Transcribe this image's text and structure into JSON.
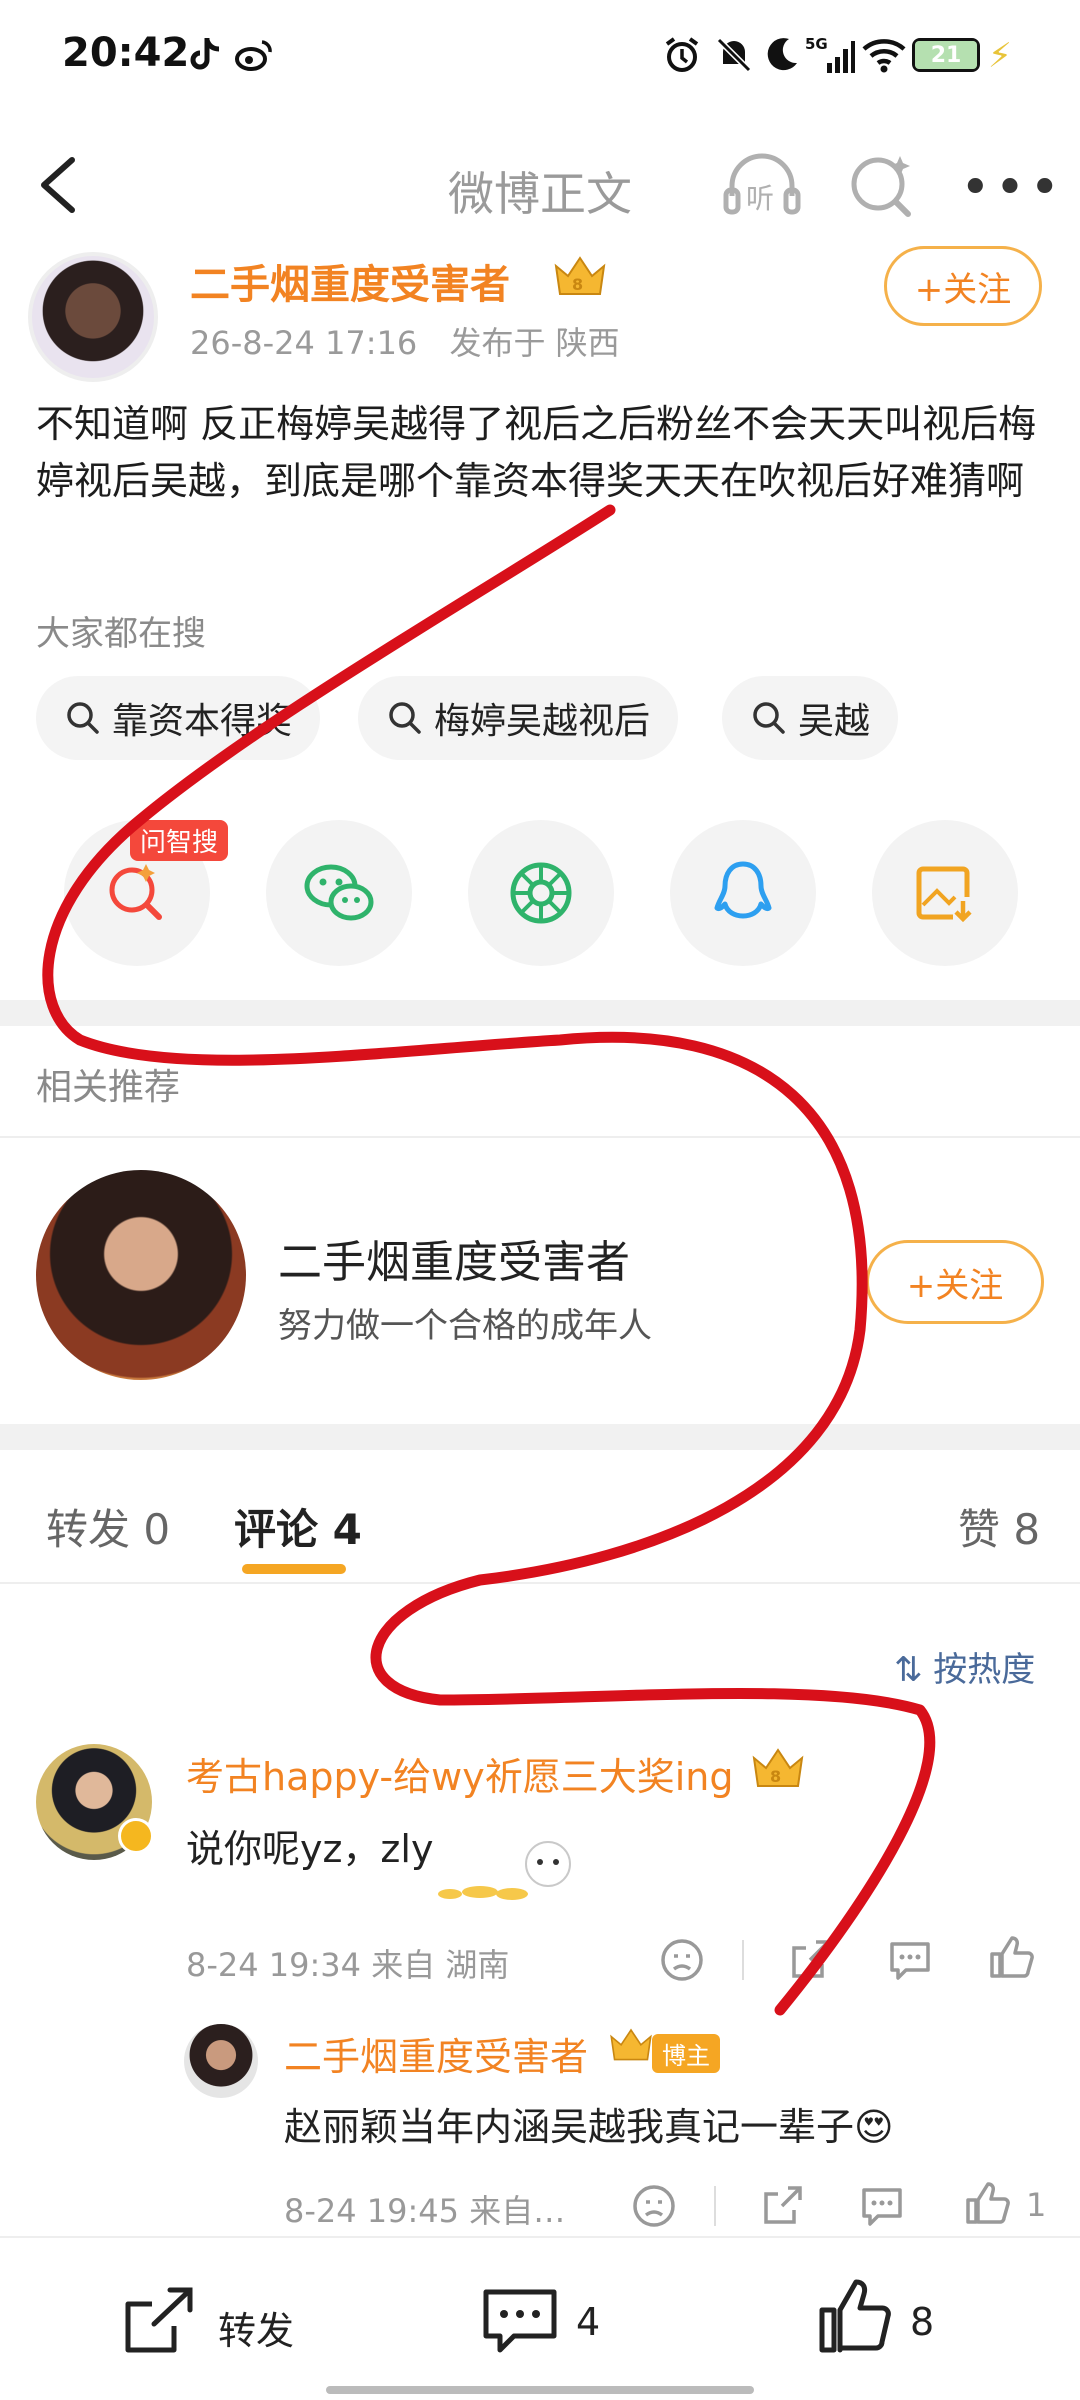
{
  "status_bar": {
    "time": "20:42",
    "network": "5G",
    "battery_level": "21",
    "icons": [
      "tiktok-icon",
      "weibo-icon",
      "alarm-icon",
      "mute-icon",
      "moon-icon",
      "signal-icon",
      "wifi-icon",
      "battery-icon",
      "charging-icon"
    ]
  },
  "nav": {
    "title": "微博正文",
    "listen_label": "听",
    "more_label": "•••"
  },
  "post": {
    "author": "二手烟重度受害者",
    "time": "26-8-24 17:16",
    "location_label": "发布于 陕西",
    "follow_label": "+关注",
    "text": "不知道啊 反正梅婷吴越得了视后之后粉丝不会天天叫视后梅婷视后吴越，到底是哪个靠资本得奖天天在吹视后好难猜啊",
    "search_hint": "大家都在搜",
    "search_chips": [
      "靠资本得奖",
      "梅婷吴越视后",
      "吴越"
    ],
    "share_tag": "问智搜"
  },
  "related": {
    "title": "相关推荐",
    "name": "二手烟重度受害者",
    "desc": "努力做一个合格的成年人",
    "follow_label": "+关注"
  },
  "tabs": {
    "repost": "转发 0",
    "comment": "评论 4",
    "like": "赞 8"
  },
  "sort_label": "⇅ 按热度",
  "comments": [
    {
      "name": "考古happy-给wy祈愿三大奖ing",
      "text": "说你呢yz，zly",
      "meta": "8-24 19:34  来自 湖南"
    },
    {
      "name": "二手烟重度受害者",
      "badge": "博主",
      "text": "赵丽颖当年内涵吴越我真记一辈子😍",
      "meta": "8-24 19:45  来自…",
      "likes": "1"
    }
  ],
  "bottom": {
    "repost_label": "转发",
    "comment_count": "4",
    "like_count": "8"
  },
  "colors": {
    "accent_orange": "#f28322",
    "follow_border": "#f5b14a",
    "scribble_red": "#d8101a",
    "badge_red": "#f4483b",
    "tab_underline": "#f5a623"
  }
}
